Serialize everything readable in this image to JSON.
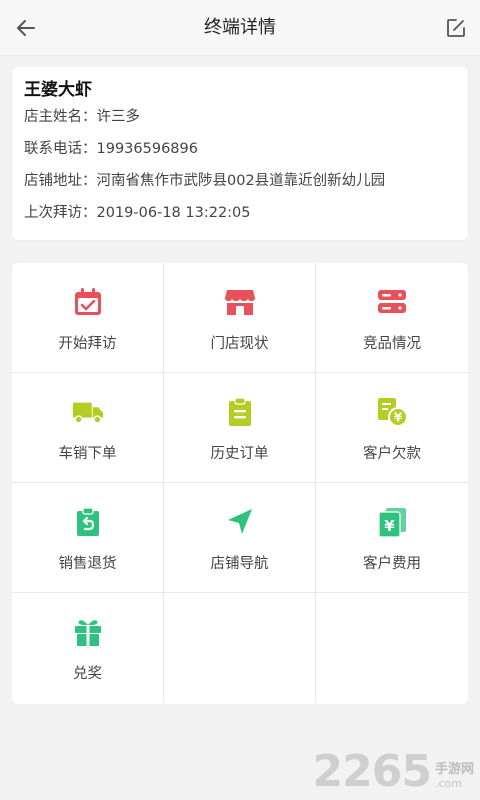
{
  "header": {
    "title": "终端详情",
    "back_icon": "arrow-left-icon",
    "edit_icon": "edit-square-icon"
  },
  "store": {
    "name": "王婆大虾",
    "owner_label": "店主姓名：",
    "owner": "许三多",
    "phone_label": "联系电话：",
    "phone": "19936596896",
    "address_label": "店铺地址：",
    "address": "河南省焦作市武陟县002县道靠近创新幼儿园",
    "last_visit_label": "上次拜访：",
    "last_visit": "2019-06-18 13:22:05"
  },
  "menu": [
    {
      "label": "开始拜访",
      "icon": "calendar-check-icon",
      "color": "#e8505b"
    },
    {
      "label": "门店现状",
      "icon": "storefront-icon",
      "color": "#e8505b"
    },
    {
      "label": "竞品情况",
      "icon": "server-stack-icon",
      "color": "#e8505b"
    },
    {
      "label": "车销下单",
      "icon": "truck-icon",
      "color": "#b3cd22"
    },
    {
      "label": "历史订单",
      "icon": "clipboard-icon",
      "color": "#b3cd22"
    },
    {
      "label": "客户欠款",
      "icon": "bill-yen-icon",
      "color": "#b3cd22"
    },
    {
      "label": "销售退货",
      "icon": "return-clipboard-icon",
      "color": "#2ec27e"
    },
    {
      "label": "店铺导航",
      "icon": "navigation-arrow-icon",
      "color": "#2ec27e"
    },
    {
      "label": "客户费用",
      "icon": "yen-cards-icon",
      "color": "#2ec27e"
    },
    {
      "label": "兑奖",
      "icon": "gift-icon",
      "color": "#2ec27e"
    }
  ],
  "watermark": {
    "number": "2265",
    "cn": "手游网",
    "domain": ".com"
  }
}
